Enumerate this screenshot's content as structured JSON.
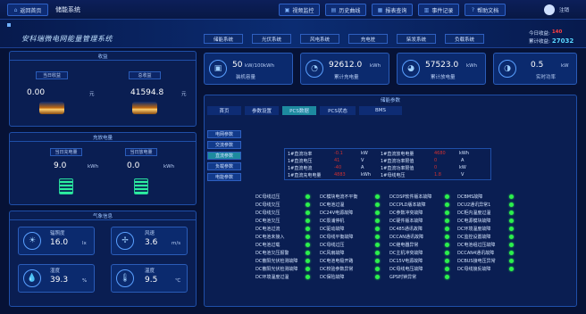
{
  "topbar": {
    "back_button": "返回首页",
    "app_title": "储能系统",
    "nav": [
      "视频监控",
      "历史曲线",
      "报表查询",
      "事件记录",
      "帮助文档"
    ],
    "logout": "注销"
  },
  "banner": {
    "title": "安科瑞微电网能量管理系统",
    "tabs": [
      "储能系统",
      "光伏系统",
      "风电系统",
      "充电桩",
      "柴发系统",
      "负载系统"
    ],
    "today_revenue_label": "今日收益:",
    "today_revenue_value": "140",
    "total_revenue_label": "累计收益:",
    "total_revenue_value": "27032"
  },
  "revenue_panel": {
    "title": "收益",
    "today_label": "当日收益",
    "total_label": "总收益",
    "today_value": "0.00",
    "total_value": "41594.8",
    "unit": "元"
  },
  "energy_panel": {
    "title": "充放电量",
    "charge_label": "当日充电量",
    "discharge_label": "当日放电量",
    "charge_value": "9.0",
    "discharge_value": "0.0",
    "unit": "kWh"
  },
  "weather_panel": {
    "title": "气象信息",
    "items": [
      {
        "label": "辐照度",
        "value": "16.0",
        "unit": "lx",
        "icon": "sun-icon"
      },
      {
        "label": "风速",
        "value": "3.6",
        "unit": "m/s",
        "icon": "fan-icon"
      },
      {
        "label": "湿度",
        "value": "39.3",
        "unit": "%",
        "icon": "droplet-icon"
      },
      {
        "label": "温度",
        "value": "9.5",
        "unit": "℃",
        "icon": "thermometer-icon"
      }
    ]
  },
  "stats": [
    {
      "value": "50",
      "unit": "kW/100kWh",
      "label": "装机容量"
    },
    {
      "value": "92612.0",
      "unit": "kWh",
      "label": "累计充电量"
    },
    {
      "value": "57523.0",
      "unit": "kWh",
      "label": "累计放电量"
    },
    {
      "value": "0.5",
      "unit": "kW",
      "label": "实时功率"
    }
  ],
  "params": {
    "title": "储能参数",
    "tabs": [
      "首页",
      "参数设置",
      "PCS数据",
      "PCS状态",
      "BMS"
    ],
    "active_tab": "PCS数据",
    "side": [
      "电网参数",
      "交流参数",
      "直流参数",
      "负载参数",
      "电能参数"
    ],
    "active_side": "直流参数",
    "table": [
      {
        "label": "1#直流功率",
        "value": "-0.1",
        "unit": "kW",
        "label2": "1#直流放电电量",
        "value2": "4680",
        "unit2": "kWh"
      },
      {
        "label": "1#直流电压",
        "value": "41",
        "unit": "V",
        "label2": "1#直流功率限值",
        "value2": "0",
        "unit2": "A"
      },
      {
        "label": "1#直流电流",
        "value": "-40",
        "unit": "A",
        "label2": "1#直流功率限值",
        "value2": "0",
        "unit2": "kW"
      },
      {
        "label": "1#直流充电电量",
        "value": "4883",
        "unit": "kWh",
        "label2": "1#母线电压",
        "value2": "1.8",
        "unit2": "V"
      }
    ],
    "alarms": [
      [
        "DC母线过压",
        "DC模块电流不平衡",
        "DCDSP软件版本故障",
        "DCBMS故障"
      ],
      [
        "DC母线欠压",
        "DC电池过温",
        "DCCPLD版本故障",
        "DCU2通讯异常1"
      ],
      [
        "DC母线欠压",
        "DC24V电源故障",
        "DC参数冲突故障",
        "DC柜内温度过温"
      ],
      [
        "DC电池欠压",
        "DC泵浦停机",
        "DC硬件版本故障",
        "DC电源模块故障"
      ],
      [
        "DC电池过流",
        "DC驱动故障",
        "DC485通讯故障",
        "DC环境温度故障"
      ],
      [
        "DC电池未接入",
        "DC母线平衡故障",
        "DCCAN通讯故障",
        "DC监控设置故障"
      ],
      [
        "DC电池过载",
        "DC母线过压",
        "DC继电器异常",
        "DC电池组过压故障"
      ],
      [
        "DC电池欠压报警",
        "DC风扇故障",
        "DC主机冲突故障",
        "DCCAN4通讯故障"
      ],
      [
        "DC散阳光伏检测故障",
        "DC电池电极开路",
        "DC15V电源故障",
        "DCBUS接电压异常"
      ],
      [
        "DC散阳光伏检测故障",
        "DC校验参数异常",
        "DC母线电压故障",
        "DC母线接反故障"
      ],
      [
        "DC环境温度过温",
        "DC保险故障",
        "GPS时钟异常",
        ""
      ]
    ]
  }
}
